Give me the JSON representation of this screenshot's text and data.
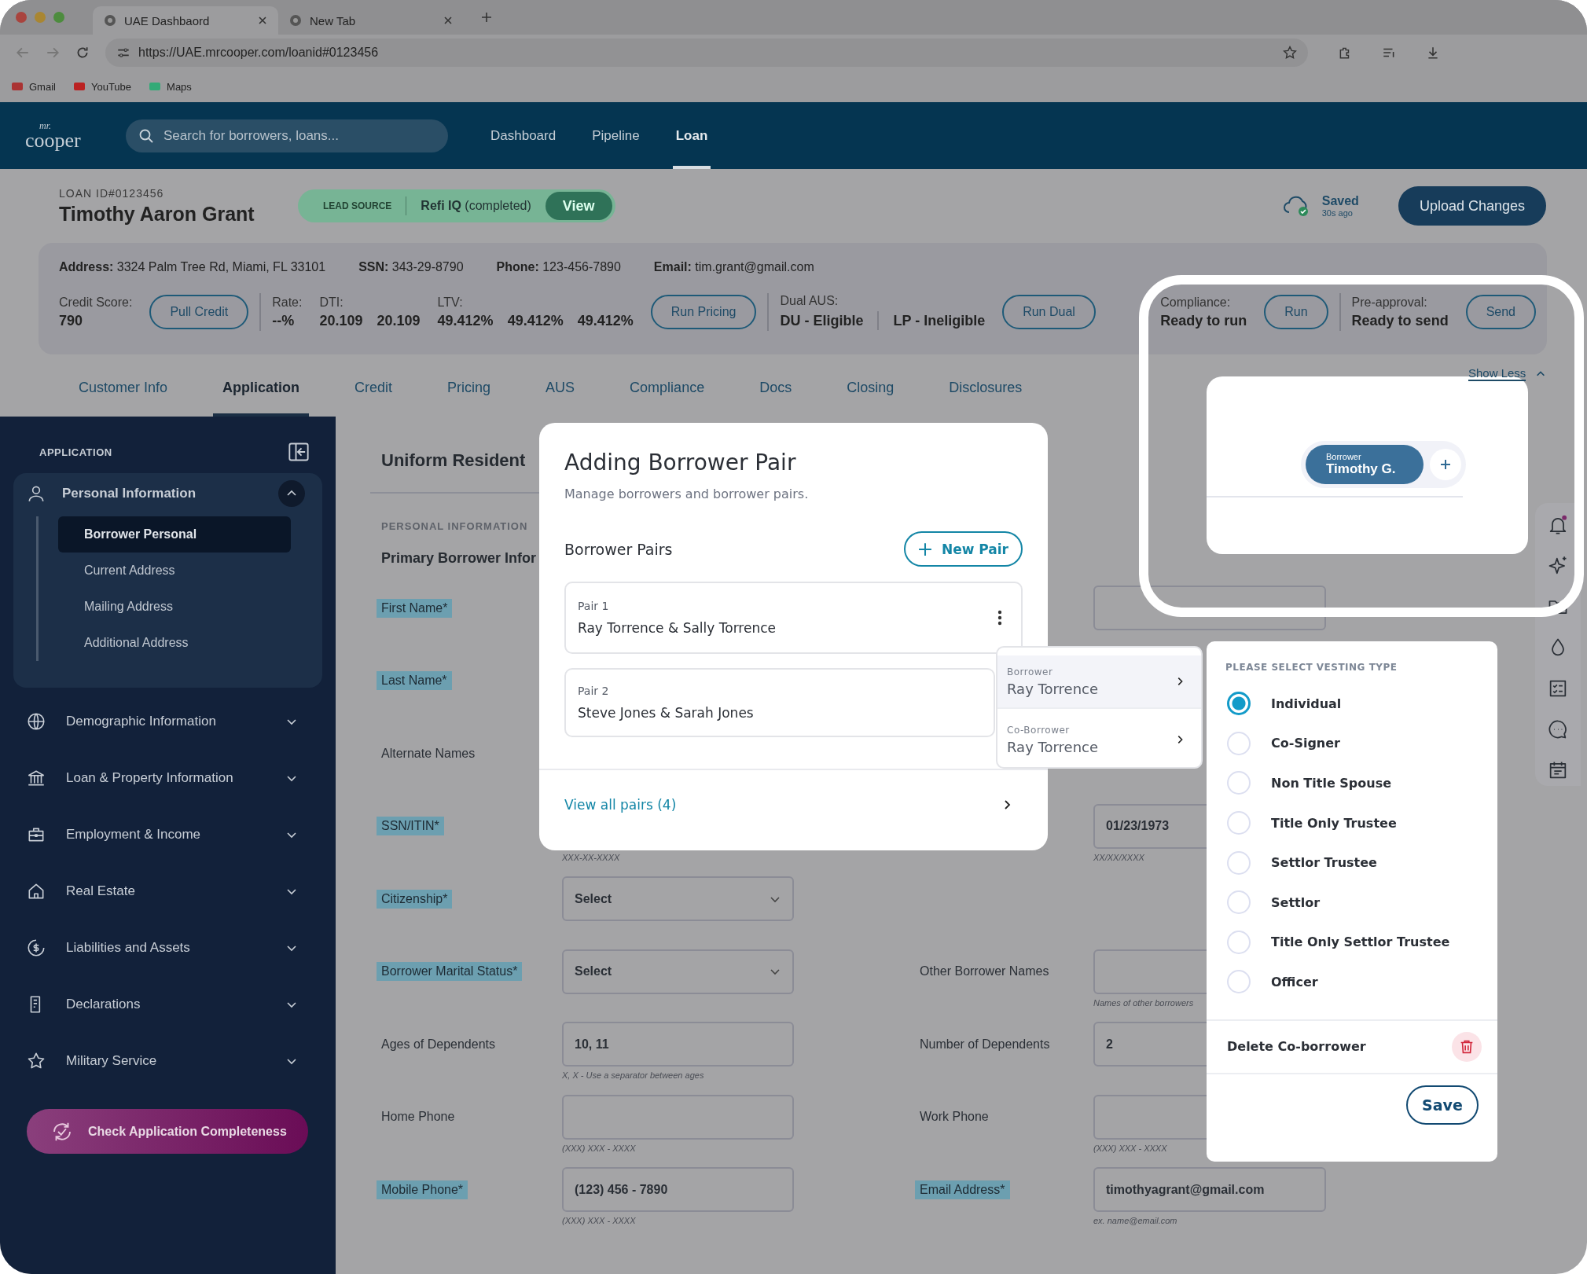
{
  "browser": {
    "tabs": [
      {
        "title": "UAE Dashbaord",
        "selected": true
      },
      {
        "title": "New Tab",
        "selected": false
      }
    ],
    "url": "https://UAE.mrcooper.com/loanid#0123456",
    "bookmarks": [
      "Gmail",
      "YouTube",
      "Maps"
    ]
  },
  "header": {
    "logo_prefix": "mr.",
    "logo": "cooper",
    "search_placeholder": "Search for borrowers, loans...",
    "nav": [
      {
        "label": "Dashboard",
        "selected": false
      },
      {
        "label": "Pipeline",
        "selected": false
      },
      {
        "label": "Loan",
        "selected": true
      }
    ]
  },
  "loan": {
    "id": "LOAN ID#0123456",
    "name": "Timothy Aaron Grant",
    "lead_source": {
      "label": "LEAD SOURCE",
      "source": "Refi IQ",
      "status": "(completed)",
      "button": "View"
    },
    "saved": {
      "title": "Saved",
      "time": "30s ago"
    },
    "upload_button": "Upload Changes"
  },
  "details": [
    {
      "label": "Address:",
      "value": "3324 Palm Tree Rd, Miami, FL 33101"
    },
    {
      "label": "SSN:",
      "value": "343-29-8790"
    },
    {
      "label": "Phone:",
      "value": "123-456-7890"
    },
    {
      "label": "Email:",
      "value": "tim.grant@gmail.com"
    }
  ],
  "metrics": [
    {
      "items": [
        {
          "label": "Credit Score:",
          "values": [
            "790"
          ]
        }
      ],
      "button": "Pull Credit"
    },
    {
      "items": [
        {
          "label": "Rate:",
          "values": [
            "--%"
          ]
        },
        {
          "label": "DTI:",
          "values": [
            "20.109",
            "20.109"
          ]
        },
        {
          "label": "LTV:",
          "values": [
            "49.412%",
            "49.412%",
            "49.412%"
          ]
        }
      ],
      "button": "Run Pricing"
    },
    {
      "items": [
        {
          "label": "Dual AUS:",
          "values": [
            "DU - Eligible",
            "LP - Ineligible"
          ],
          "divided": true
        }
      ],
      "button": "Run Dual"
    },
    {
      "items": [
        {
          "label": "Compliance:",
          "values": [
            "Ready to run"
          ]
        }
      ],
      "button": "Run"
    },
    {
      "items": [
        {
          "label": "Pre-approval:",
          "values": [
            "Ready to send"
          ]
        }
      ],
      "button": "Send"
    }
  ],
  "tabs": [
    {
      "label": "Customer Info",
      "selected": false
    },
    {
      "label": "Application",
      "selected": true
    },
    {
      "label": "Credit",
      "selected": false
    },
    {
      "label": "Pricing",
      "selected": false
    },
    {
      "label": "AUS",
      "selected": false
    },
    {
      "label": "Compliance",
      "selected": false
    },
    {
      "label": "Docs",
      "selected": false
    },
    {
      "label": "Closing",
      "selected": false
    },
    {
      "label": "Disclosures",
      "selected": false
    }
  ],
  "show_less": "Show Less",
  "borrower_chip": {
    "role": "Borrower",
    "name": "Timothy G."
  },
  "sidebar": {
    "title": "APPLICATION",
    "sections": [
      {
        "label": "Personal Information",
        "expanded": true,
        "children": [
          {
            "label": "Borrower Personal",
            "selected": true
          },
          {
            "label": "Current Address",
            "selected": false
          },
          {
            "label": "Mailing Address",
            "selected": false
          },
          {
            "label": "Additional Address",
            "selected": false
          }
        ]
      },
      {
        "label": "Demographic Information",
        "expanded": false
      },
      {
        "label": "Loan & Property Information",
        "expanded": false
      },
      {
        "label": "Employment & Income",
        "expanded": false
      },
      {
        "label": "Real Estate",
        "expanded": false
      },
      {
        "label": "Liabilities and Assets",
        "expanded": false
      },
      {
        "label": "Declarations",
        "expanded": false
      },
      {
        "label": "Military Service",
        "expanded": false
      }
    ],
    "button": "Check Application Completeness"
  },
  "form": {
    "title": "Uniform Resident",
    "section": "PERSONAL INFORMATION",
    "subtitle": "Primary Borrower Infor",
    "rows": [
      {
        "label": "First Name*",
        "highlighted": true,
        "col2": {
          "field": {
            "kind": "text"
          }
        }
      },
      {
        "label": "Last Name*",
        "highlighted": true
      },
      {
        "label": "Alternate Names",
        "highlighted": false
      },
      {
        "label": "SSN/ITIN*",
        "highlighted": true,
        "helper": "XXX-XX-XXXX",
        "col2": {
          "field": {
            "kind": "text",
            "value": "01/23/1973"
          },
          "helper": "XX/XX/XXXX"
        }
      },
      {
        "label": "Citizenship*",
        "highlighted": true,
        "field": {
          "kind": "select",
          "value": "Select"
        }
      },
      {
        "label": "Borrower Marital Status*",
        "highlighted": true,
        "field": {
          "kind": "select",
          "value": "Select"
        },
        "col2": {
          "label": "Other Borrower Names",
          "highlighted": false,
          "field": {
            "kind": "text"
          },
          "helper": "Names of other borrowers"
        }
      },
      {
        "label": "Ages of Dependents",
        "highlighted": false,
        "field": {
          "kind": "text",
          "value": "10, 11"
        },
        "helper": "X, X - Use a separator between ages",
        "col2": {
          "label": "Number of Dependents",
          "highlighted": false,
          "field": {
            "kind": "text",
            "value": "2"
          }
        }
      },
      {
        "label": "Home Phone",
        "highlighted": false,
        "field": {
          "kind": "text"
        },
        "helper": "(XXX) XXX - XXXX",
        "col2": {
          "label": "Work Phone",
          "highlighted": false,
          "field": {
            "kind": "text"
          },
          "helper": "(XXX) XXX - XXXX"
        }
      },
      {
        "label": "Mobile Phone*",
        "highlighted": true,
        "field": {
          "kind": "text",
          "value": "(123) 456 - 7890"
        },
        "helper": "(XXX) XXX - XXXX",
        "col2": {
          "label": "Email Address*",
          "highlighted": true,
          "field": {
            "kind": "text",
            "value": "timothyagrant@gmail.com"
          },
          "helper": "ex. name@email.com"
        }
      }
    ]
  },
  "modal": {
    "title": "Adding Borrower Pair",
    "subtitle": "Manage borrowers and borrower pairs.",
    "section": "Borrower Pairs",
    "new_button": "New Pair",
    "pairs": [
      {
        "label": "Pair 1",
        "names": "Ray Torrence & Sally Torrence",
        "menu": true
      },
      {
        "label": "Pair 2",
        "names": "Steve Jones & Sarah Jones",
        "menu": false
      }
    ],
    "view_all": "View all pairs (4)"
  },
  "pair_menu": [
    {
      "role": "Borrower",
      "name": "Ray Torrence",
      "selected": true
    },
    {
      "role": "Co-Borrower",
      "name": "Ray Torrence",
      "selected": false
    }
  ],
  "vesting": {
    "title": "PLEASE SELECT VESTING TYPE",
    "options": [
      {
        "label": "Individual",
        "selected": true
      },
      {
        "label": "Co-Signer",
        "selected": false
      },
      {
        "label": "Non Title Spouse",
        "selected": false
      },
      {
        "label": "Title Only Trustee",
        "selected": false
      },
      {
        "label": "Settlor Trustee",
        "selected": false
      },
      {
        "label": "Settlor",
        "selected": false
      },
      {
        "label": "Title Only Settlor Trustee",
        "selected": false
      },
      {
        "label": "Officer",
        "selected": false
      }
    ],
    "delete": "Delete Co-borrower",
    "save": "Save"
  }
}
